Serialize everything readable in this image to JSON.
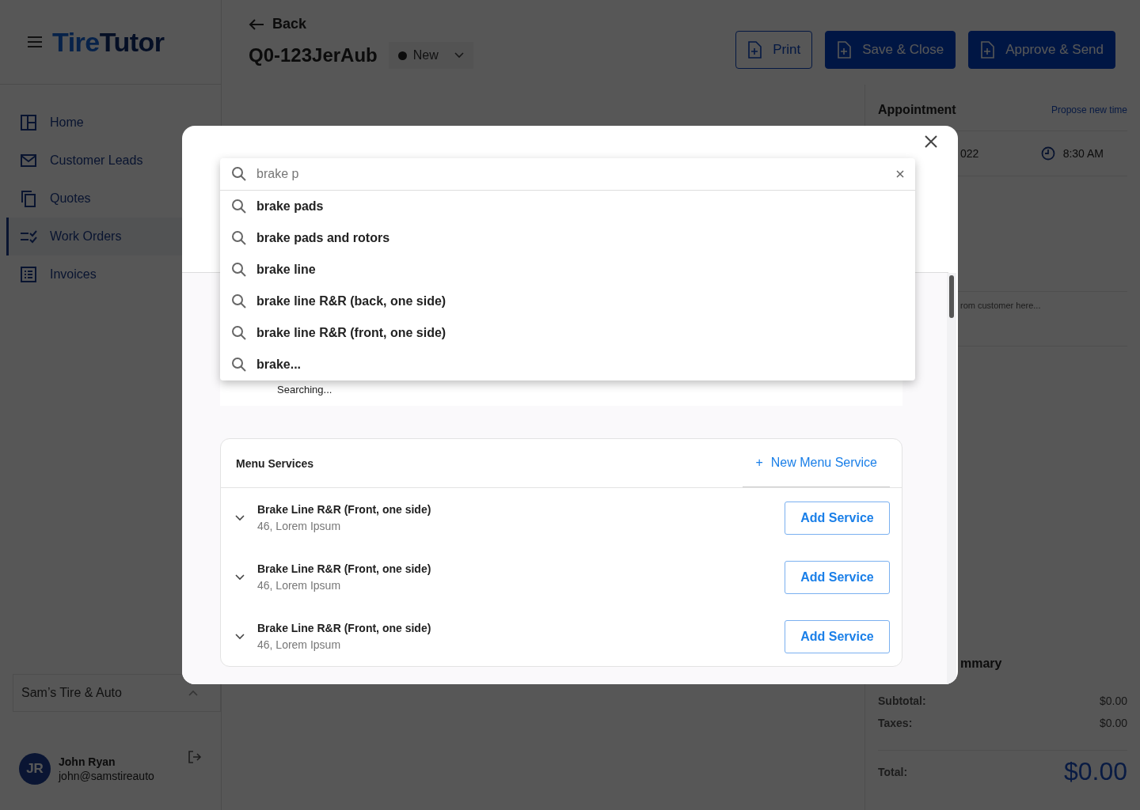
{
  "sidebar": {
    "logo": [
      "Tire",
      "Tutor"
    ],
    "items": [
      {
        "label": "Home",
        "selected": false
      },
      {
        "label": "Customer Leads",
        "selected": false
      },
      {
        "label": "Quotes",
        "selected": false
      },
      {
        "label": "Work Orders",
        "selected": true
      },
      {
        "label": "Invoices",
        "selected": false
      }
    ],
    "shop": "Sam’s Tire & Auto",
    "user": {
      "initials": "JR",
      "name": "John Ryan",
      "email": "john@samstireauto"
    }
  },
  "header": {
    "back": "Back",
    "title": "Q0-123JerAub",
    "status": "New",
    "buttons": [
      {
        "label": "Print",
        "kind": "outline"
      },
      {
        "label": "Save & Close",
        "kind": "filled"
      },
      {
        "label": "Approve & Send",
        "kind": "filled"
      }
    ]
  },
  "right_panel": {
    "appointment_title": "Appointment",
    "propose_link": "Propose new time",
    "date": "022",
    "time": "8:30 AM",
    "notes_placeholder": "rom customer here...",
    "summary_title": "mmary",
    "summary": [
      {
        "label": "Subtotal:",
        "value": "$0.00"
      },
      {
        "label": "Taxes:",
        "value": "$0.00"
      }
    ],
    "total_label": "Total:",
    "total": "$0.00"
  },
  "modal": {
    "search": {
      "value": "brake p"
    },
    "suggestions": [
      "brake pads",
      "brake pads and rotors",
      "brake line",
      "brake line R&R (back, one side)",
      "brake line R&R (front, one side)",
      "brake..."
    ],
    "searching": "Searching...",
    "menu_services": {
      "title": "Menu Services",
      "new_link": "New Menu Service",
      "new_icon": "+",
      "rows": [
        {
          "title": "Brake Line R&R (Front, one side)",
          "subtitle": "46, Lorem Ipsum",
          "button": "Add Service"
        },
        {
          "title": "Brake Line R&R (Front, one side)",
          "subtitle": "46, Lorem Ipsum",
          "button": "Add Service"
        },
        {
          "title": "Brake Line R&R (Front, one side)",
          "subtitle": "46, Lorem Ipsum",
          "button": "Add Service"
        }
      ]
    }
  }
}
